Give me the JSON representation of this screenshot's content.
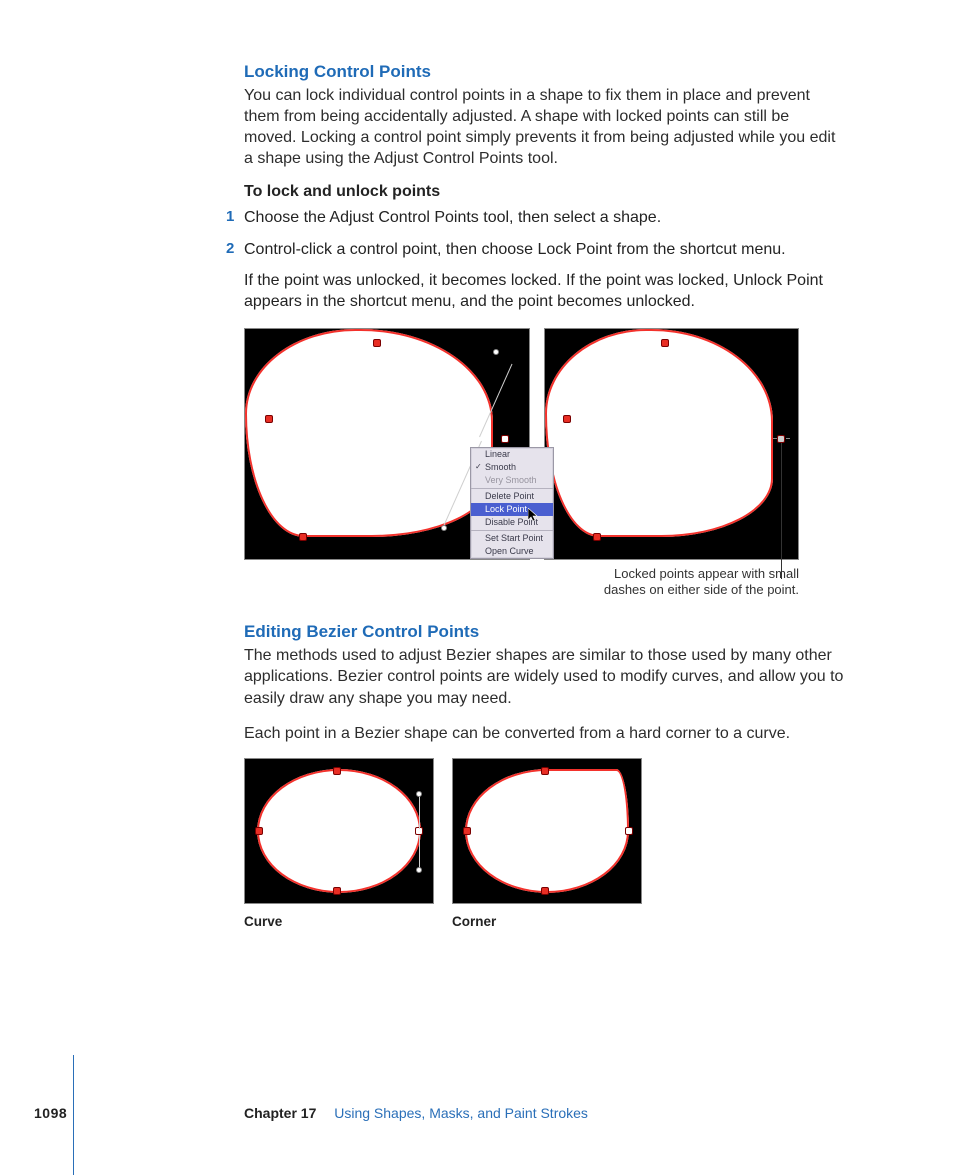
{
  "sections": {
    "locking": {
      "title": "Locking Control Points",
      "intro": "You can lock individual control points in a shape to fix them in place and prevent them from being accidentally adjusted. A shape with locked points can still be moved. Locking a control point simply prevents it from being adjusted while you edit a shape using the Adjust Control Points tool.",
      "task_heading": "To lock and unlock points",
      "steps": [
        "Choose the Adjust Control Points tool, then select a shape.",
        "Control-click a control point, then choose Lock Point from the shortcut menu."
      ],
      "followup": "If the point was unlocked, it becomes locked. If the point was locked, Unlock Point appears in the shortcut menu, and the point becomes unlocked.",
      "callout": "Locked points appear with small dashes on either side of the point."
    },
    "bezier": {
      "title": "Editing Bezier Control Points",
      "intro": "The methods used to adjust Bezier shapes are similar to those used by many other applications. Bezier control points are widely used to modify curves, and allow you to easily draw any shape you may need.",
      "para2": "Each point in a Bezier shape can be converted from a hard corner to a curve."
    }
  },
  "context_menu": {
    "items": [
      {
        "label": "Linear",
        "dim": false,
        "checked": false
      },
      {
        "label": "Smooth",
        "dim": false,
        "checked": true
      },
      {
        "label": "Very Smooth",
        "dim": true,
        "checked": false
      }
    ],
    "group2": [
      {
        "label": "Delete Point"
      },
      {
        "label": "Lock Point",
        "selected": true
      },
      {
        "label": "Disable Point"
      }
    ],
    "group3": [
      {
        "label": "Set Start Point"
      },
      {
        "label": "Open Curve"
      }
    ]
  },
  "figure_labels": {
    "curve": "Curve",
    "corner": "Corner"
  },
  "step_numbers": [
    "1",
    "2"
  ],
  "footer": {
    "page": "1098",
    "chapter_label": "Chapter 17",
    "chapter_title": "Using Shapes, Masks, and Paint Strokes"
  }
}
